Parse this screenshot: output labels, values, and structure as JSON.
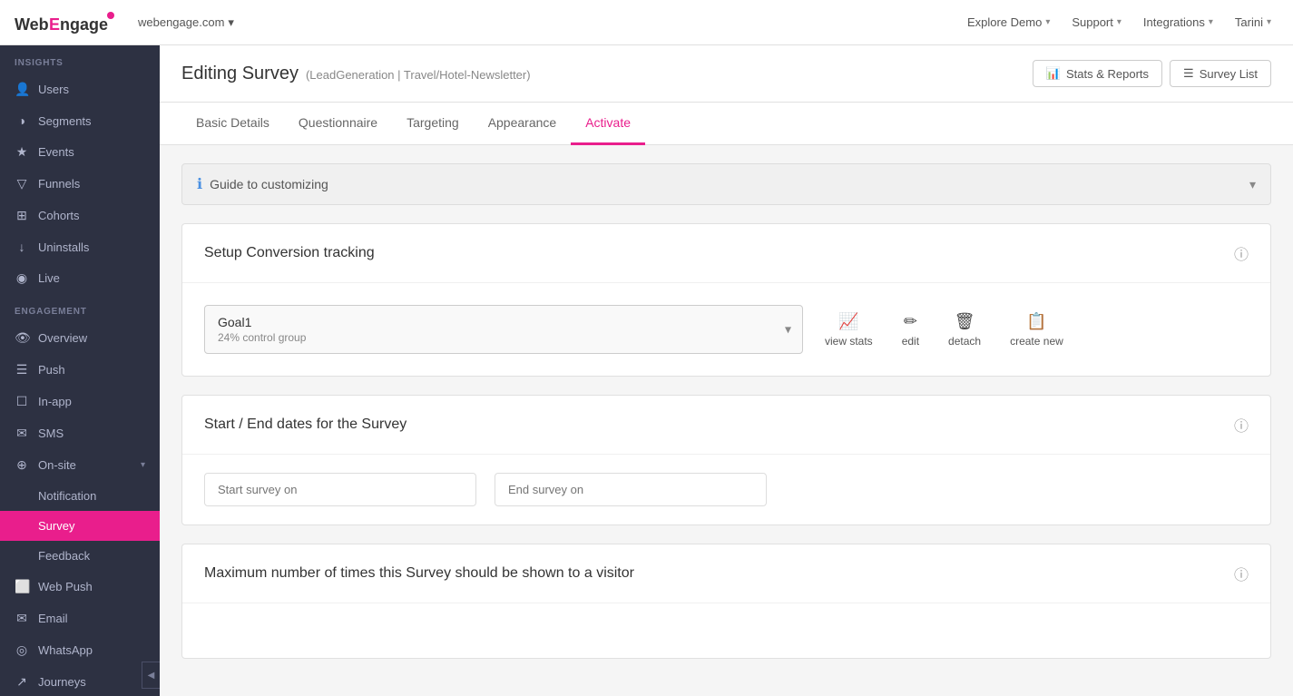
{
  "topNav": {
    "logoText": "WebEngage",
    "domain": "webengage.com",
    "domainChevron": "▾",
    "navItems": [
      {
        "label": "Explore Demo",
        "chevron": "▾"
      },
      {
        "label": "Support",
        "chevron": "▾"
      },
      {
        "label": "Integrations",
        "chevron": "▾"
      },
      {
        "label": "Tarini",
        "chevron": "▾"
      }
    ]
  },
  "sidebar": {
    "sections": [
      {
        "label": "INSIGHTS",
        "items": [
          {
            "id": "users",
            "label": "Users",
            "icon": "👤"
          },
          {
            "id": "segments",
            "label": "Segments",
            "icon": "◑"
          },
          {
            "id": "events",
            "label": "Events",
            "icon": "★"
          },
          {
            "id": "funnels",
            "label": "Funnels",
            "icon": "▽"
          },
          {
            "id": "cohorts",
            "label": "Cohorts",
            "icon": "⊞"
          },
          {
            "id": "uninstalls",
            "label": "Uninstalls",
            "icon": "↓"
          },
          {
            "id": "live",
            "label": "Live",
            "icon": "◉"
          }
        ]
      },
      {
        "label": "ENGAGEMENT",
        "items": [
          {
            "id": "overview",
            "label": "Overview",
            "icon": "👁"
          },
          {
            "id": "push",
            "label": "Push",
            "icon": "☰"
          },
          {
            "id": "in-app",
            "label": "In-app",
            "icon": "☐"
          },
          {
            "id": "sms",
            "label": "SMS",
            "icon": "✉"
          },
          {
            "id": "on-site",
            "label": "On-site",
            "icon": "⊕",
            "hasArrow": true
          },
          {
            "id": "notification",
            "label": "Notification",
            "icon": "",
            "sub": true
          },
          {
            "id": "survey",
            "label": "Survey",
            "icon": "",
            "sub": true,
            "active": true
          },
          {
            "id": "feedback",
            "label": "Feedback",
            "icon": "",
            "sub": true
          },
          {
            "id": "web-push",
            "label": "Web Push",
            "icon": "⬜"
          },
          {
            "id": "email",
            "label": "Email",
            "icon": "✉"
          },
          {
            "id": "whatsapp",
            "label": "WhatsApp",
            "icon": "◎"
          },
          {
            "id": "journeys",
            "label": "Journeys",
            "icon": "↗"
          }
        ]
      }
    ]
  },
  "pageHeader": {
    "title": "Editing Survey",
    "subtitle": "(LeadGeneration | Travel/Hotel-Newsletter)",
    "buttons": [
      {
        "id": "stats-reports",
        "label": "Stats & Reports",
        "icon": "📊"
      },
      {
        "id": "survey-list",
        "label": "Survey List",
        "icon": "☰"
      }
    ]
  },
  "tabs": [
    {
      "id": "basic-details",
      "label": "Basic Details"
    },
    {
      "id": "questionnaire",
      "label": "Questionnaire"
    },
    {
      "id": "targeting",
      "label": "Targeting"
    },
    {
      "id": "appearance",
      "label": "Appearance"
    },
    {
      "id": "activate",
      "label": "Activate",
      "active": true
    }
  ],
  "guideBar": {
    "label": "Guide to customizing"
  },
  "sections": [
    {
      "id": "conversion-tracking",
      "title": "Setup Conversion tracking",
      "goal": {
        "name": "Goal1",
        "sub": "24% control group"
      },
      "actions": [
        {
          "id": "view-stats",
          "label": "view stats",
          "icon": "📈"
        },
        {
          "id": "edit",
          "label": "edit",
          "icon": "✏"
        },
        {
          "id": "detach",
          "label": "detach",
          "icon": "🗑"
        },
        {
          "id": "create-new",
          "label": "create new",
          "icon": "📋"
        }
      ]
    },
    {
      "id": "start-end-dates",
      "title": "Start / End dates for the Survey",
      "startPlaceholder": "Start survey on",
      "endPlaceholder": "End survey on"
    },
    {
      "id": "max-times",
      "title": "Maximum number of times this Survey should be shown to a visitor"
    }
  ]
}
